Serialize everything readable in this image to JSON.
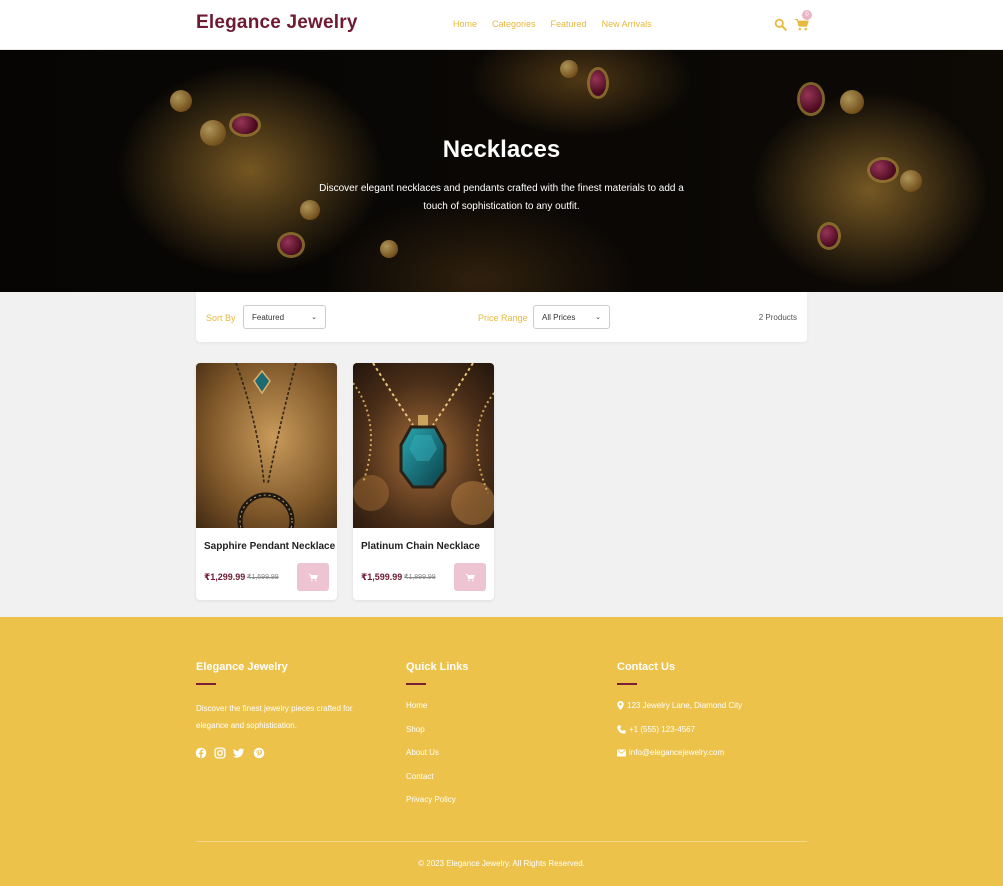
{
  "header": {
    "logo": "Elegance Jewelry",
    "nav": [
      "Home",
      "Categories",
      "Featured",
      "New Arrivals"
    ],
    "cart_count": "0"
  },
  "hero": {
    "title": "Necklaces",
    "subtitle": "Discover elegant necklaces and pendants crafted with the finest materials to add a touch of sophistication to any outfit."
  },
  "filters": {
    "sort_label": "Sort By",
    "sort_value": "Featured",
    "price_label": "Price Range",
    "price_value": "All Prices",
    "count": "2 Products"
  },
  "products": [
    {
      "name": "Sapphire Pendant Necklace",
      "price": "₹1,299.99",
      "old_price": "₹1,699.99"
    },
    {
      "name": "Platinum Chain Necklace",
      "price": "₹1,599.99",
      "old_price": "₹1,899.99"
    }
  ],
  "footer": {
    "brand_title": "Elegance Jewelry",
    "about": "Discover the finest jewelry pieces crafted for elegance and sophistication.",
    "quick_links_title": "Quick Links",
    "quick_links": [
      "Home",
      "Shop",
      "About Us",
      "Contact",
      "Privacy Policy"
    ],
    "contact_title": "Contact Us",
    "address": "123 Jewelry Lane, Diamond City",
    "phone": "+1 (555) 123-4567",
    "email": "info@elegancejewelry.com",
    "copyright": "© 2023 Elegance Jewelry. All Rights Reserved."
  },
  "colors": {
    "brand": "#6e1a32",
    "accent_gold": "#e9b93f",
    "footer_bg": "#ecc24a",
    "cart_button": "#efc4d2"
  },
  "icons": [
    "search-icon",
    "cart-icon",
    "facebook-icon",
    "instagram-icon",
    "twitter-icon",
    "pinterest-icon",
    "map-marker-icon",
    "phone-icon",
    "envelope-icon"
  ]
}
